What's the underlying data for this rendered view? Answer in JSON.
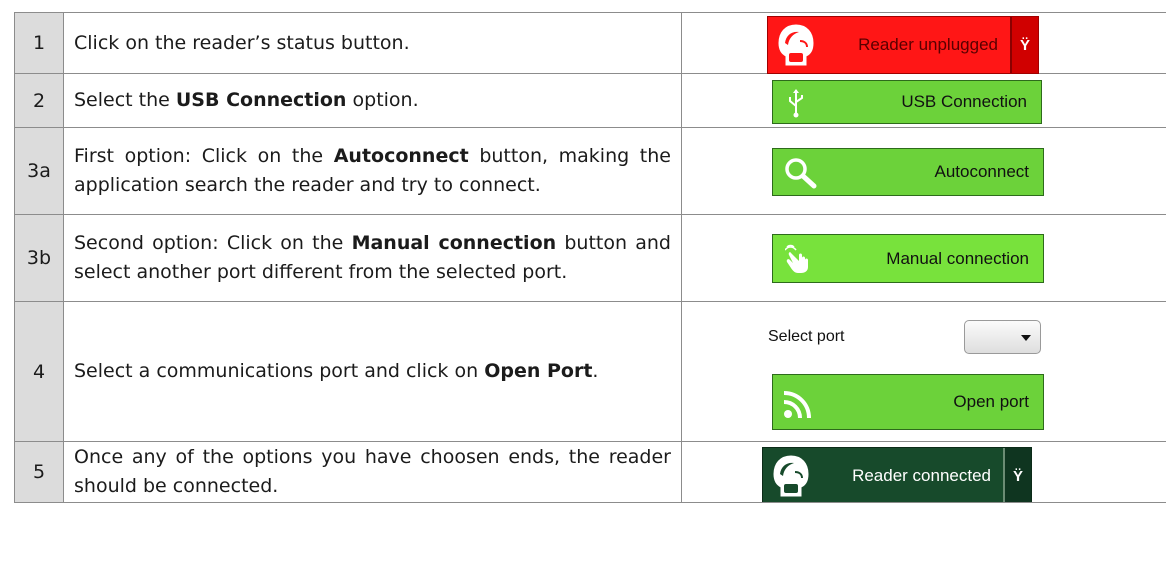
{
  "steps": [
    {
      "num": "1",
      "text": "Click on the reader’s status button."
    },
    {
      "num": "2",
      "pre": "Select the ",
      "bold": "USB Connection",
      "post": " option."
    },
    {
      "num": "3a",
      "pre": "First option: Click on the ",
      "bold": "Autoconnect",
      "post": " button, making the application search the reader and try to connect."
    },
    {
      "num": "3b",
      "pre": "Second option: Click on the ",
      "bold": "Manual connection",
      "post": " button and select another port different from the selected port."
    },
    {
      "num": "4",
      "pre": "Select a communications port and click on ",
      "bold": "Open Port",
      "post": "."
    },
    {
      "num": "5",
      "text": "Once any of the options you have choosen ends, the reader should be connected."
    }
  ],
  "buttons": {
    "reader_unplugged": "Reader unplugged",
    "usb_connection": "USB Connection",
    "autoconnect": "Autoconnect",
    "manual_connection": "Manual connection",
    "select_port_label": "Select port",
    "open_port": "Open port",
    "reader_connected": "Reader connected",
    "dropdown_glyph": "Ÿ"
  },
  "colors": {
    "unplugged_red": "#ff1616",
    "connected_dark_green": "#174a2b",
    "button_green": "#6cd23a"
  }
}
